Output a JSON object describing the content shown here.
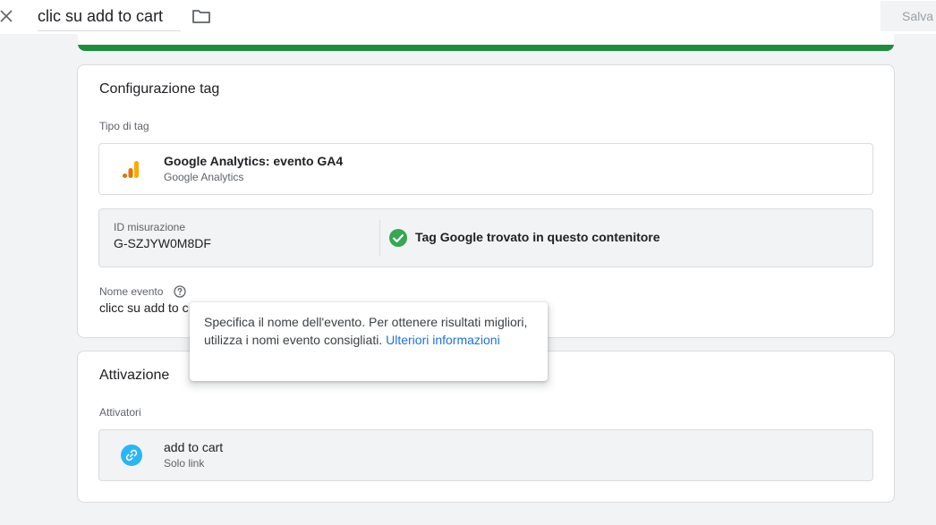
{
  "header": {
    "title": "clic su add to cart",
    "save_label": "Salva",
    "close_icon": "close-icon",
    "folder_icon": "folder-icon"
  },
  "tag_config": {
    "title": "Configurazione tag",
    "tag_type_label": "Tipo di tag",
    "tag_type": {
      "name": "Google Analytics: evento GA4",
      "provider": "Google Analytics",
      "icon": "google-analytics-icon"
    },
    "measurement": {
      "label": "ID misurazione",
      "value": "G-SZJYW0M8DF",
      "status": "Tag Google trovato in questo contenitore",
      "status_icon": "check-circle-icon",
      "status_color": "#34a853"
    },
    "event_name_label": "Nome evento",
    "event_name_value": "clicc su add to c",
    "help_icon": "help-icon"
  },
  "tooltip": {
    "text": "Specifica il nome dell'evento. Per ottenere risultati migliori, utilizza i nomi evento consigliati.",
    "link_text": "Ulteriori informazioni",
    "link_color": "#1a73e8"
  },
  "triggering": {
    "title": "Attivazione",
    "triggers_label": "Attivatori",
    "trigger": {
      "name": "add to cart",
      "type": "Solo link",
      "icon": "link-icon",
      "icon_color": "#29b6f6"
    }
  },
  "colors": {
    "accent_green": "#1e8e3e",
    "background": "#f1f3f4"
  }
}
